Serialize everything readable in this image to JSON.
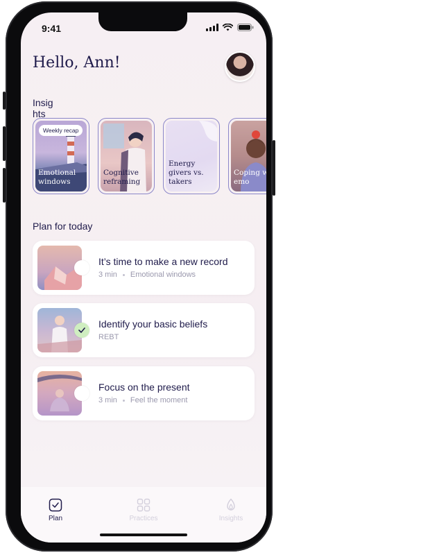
{
  "status_bar": {
    "time": "9:41"
  },
  "header": {
    "greeting": "Hello, Ann!"
  },
  "insights": {
    "title": "Insights",
    "cards": [
      {
        "label": "Emotional windows",
        "badge": "Weekly recap"
      },
      {
        "label": "Cognitive reframing"
      },
      {
        "label": "Energy givers vs. takers"
      },
      {
        "label": "Coping with emo"
      }
    ]
  },
  "plan": {
    "title": "Plan for today",
    "tasks": [
      {
        "title": "It’s time to make a new record",
        "duration": "3 min",
        "category": "Emotional windows",
        "done": false
      },
      {
        "title": "Identify your basic beliefs",
        "category": "REBT",
        "done": true
      },
      {
        "title": "Focus on the present",
        "duration": "3 min",
        "category": "Feel the moment",
        "done": false
      }
    ]
  },
  "tabbar": {
    "tabs": [
      {
        "label": "Plan",
        "icon": "calendar-check-icon",
        "active": true
      },
      {
        "label": "Practices",
        "icon": "grid-icon",
        "active": false
      },
      {
        "label": "Insights",
        "icon": "flame-icon",
        "active": false
      }
    ]
  },
  "colors": {
    "accent": "#1f1b4b",
    "card_border": "#8b86c9",
    "check_done": "#cfeec0",
    "inactive_tab": "#d3cfdc"
  }
}
